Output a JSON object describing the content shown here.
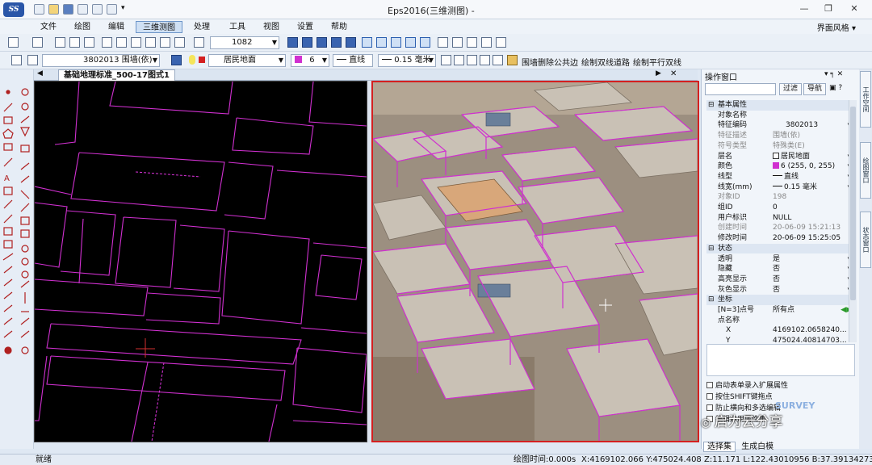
{
  "app": {
    "title": "Eps2016(三维测图) -",
    "logo_text": "SS",
    "window_controls": [
      "—",
      "❐",
      "✕"
    ]
  },
  "menu": {
    "items": [
      "文件",
      "绘图",
      "编辑",
      "三维测图",
      "处理",
      "工具",
      "视图",
      "设置",
      "帮助"
    ],
    "active": "三维测图",
    "style_label": "界面风格 ▾"
  },
  "toolbar1": {
    "scale_value": "1082"
  },
  "toolbar2": {
    "feature_code": "3802013 围墙(依)",
    "layer": "居民地面",
    "color": "6",
    "linetype": "直线",
    "linewidth": "0.15 毫米",
    "btn_remove_edge": "围墙删除公共边",
    "btn_double_line": "绘制双线道路",
    "btn_parallel": "绘制平行双线"
  },
  "document": {
    "tab_label": "基础地理标准_500-17图式1"
  },
  "colors": {
    "feature_magenta": "#d030d0",
    "view_border": "#d42020",
    "cursor_red": "#d43030"
  },
  "panel": {
    "title": "操作窗口",
    "btn_filter": "过滤",
    "btn_nav": "导航",
    "sections": {
      "basic": "基本属性",
      "state": "状态",
      "coord": "坐标"
    },
    "rows": {
      "obj_name": {
        "k": "对象名称",
        "v": ""
      },
      "feature_code": {
        "k": "特征编码",
        "v": "3802013"
      },
      "feature_desc": {
        "k": "特征描述",
        "v": "围墙(依)"
      },
      "symbol_type": {
        "k": "符号类型",
        "v": "特殊类(E)"
      },
      "layer": {
        "k": "层名",
        "v": "居民地面"
      },
      "color": {
        "k": "颜色",
        "v": "6 (255, 0, 255)"
      },
      "linetype": {
        "k": "线型",
        "v": "直线"
      },
      "linewidth": {
        "k": "线宽(mm)",
        "v": "0.15 毫米"
      },
      "obj_id": {
        "k": "对象ID",
        "v": "198"
      },
      "group_id": {
        "k": "组ID",
        "v": "0"
      },
      "user_tag": {
        "k": "用户标识",
        "v": "NULL"
      },
      "create_time": {
        "k": "创建时间",
        "v": "20-06-09 15:21:13"
      },
      "modify_time": {
        "k": "修改时间",
        "v": "20-06-09 15:25:05"
      },
      "transparent": {
        "k": "透明",
        "v": "是"
      },
      "hidden": {
        "k": "隐藏",
        "v": "否"
      },
      "highlight": {
        "k": "高亮显示",
        "v": "否"
      },
      "gray": {
        "k": "灰色显示",
        "v": "否"
      },
      "points": {
        "k": "[N=3]点号",
        "v": "所有点"
      },
      "point_name": {
        "k": "点名称",
        "v": ""
      },
      "x": {
        "k": "X",
        "v": "4169102.0658240..."
      },
      "y": {
        "k": "Y",
        "v": "475024.40814703..."
      }
    },
    "options": [
      "启动表单录入扩展属性",
      "按住SHIFT键拖点",
      "防止横向和多选编辑",
      "编辑启用属性集"
    ],
    "bottom_tabs": [
      "选择集",
      "生成白模"
    ]
  },
  "dock": [
    "工作空间",
    "绘图窗口",
    "状态窗口"
  ],
  "status": {
    "left": "就绪",
    "draw_time": "绘图时间:0.000s",
    "coords": "X:4169102.066 Y:475024.408 Z:11.171 L:122.43010956 B:37.39134273"
  },
  "watermark": {
    "brand": "启为云分享",
    "survey": "SURVEY"
  }
}
